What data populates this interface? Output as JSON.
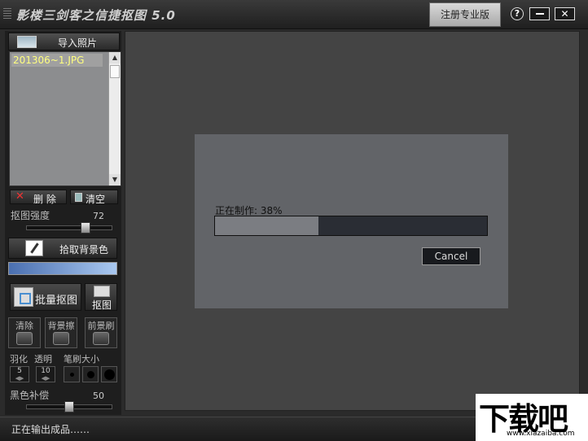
{
  "app": {
    "title": "影楼三剑客之信捷抠图 5.0",
    "register_label": "注册专业版",
    "help_label": "?",
    "close_label": "✕"
  },
  "left_panel": {
    "import_label": "导入照片",
    "files": [
      "201306~1.JPG"
    ],
    "delete_label": "删 除",
    "clear_label": "清空",
    "strength_label": "抠图强度",
    "strength_value": "72",
    "strength_fraction": 0.72,
    "pick_bg_label": "拾取背景色",
    "batch_label": "批量抠图",
    "cut_label": "抠图",
    "tools": [
      "清除",
      "背景擦",
      "前景刷"
    ],
    "feather_label": "羽化",
    "feather_value": "5",
    "opacity_label": "透明",
    "opacity_value": "10",
    "brush_size_label": "笔刷大小",
    "black_comp_label": "黑色补偿",
    "black_comp_value": "50",
    "black_comp_fraction": 0.5
  },
  "dialog": {
    "progress_text": "正在制作: 38%",
    "progress": 0.38,
    "cancel_label": "Cancel"
  },
  "status": {
    "text": "正在输出成品……"
  },
  "watermark": {
    "big": "下载吧",
    "small": "www.xiazaiba.com"
  }
}
